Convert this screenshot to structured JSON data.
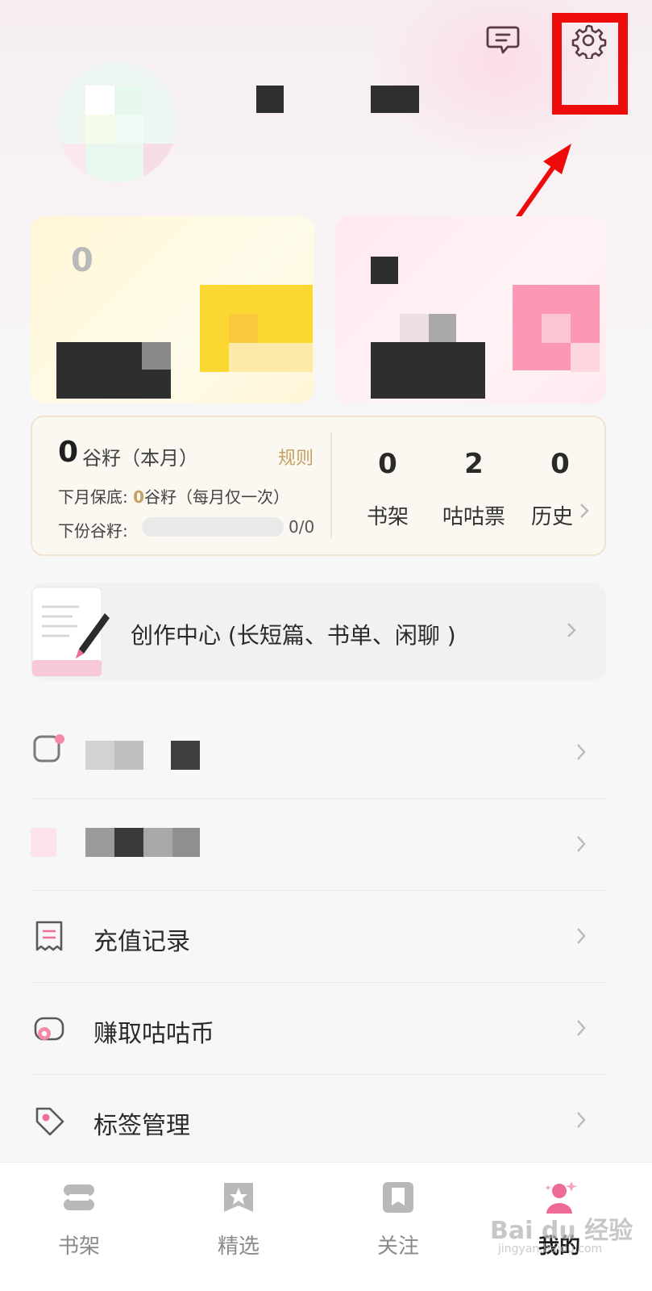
{
  "colors": {
    "accent_gold": "#c6a163",
    "highlight_red": "#ee0b0b",
    "active_pink": "#ec6a93"
  },
  "header": {
    "message_icon": "message-icon",
    "settings_icon": "gear-icon"
  },
  "vip_card": {
    "value": "0"
  },
  "grain": {
    "value": "0",
    "label": "谷籽（本月）",
    "rules": "规则",
    "guarantee_prefix": "下月保底: ",
    "guarantee_value": "0",
    "guarantee_suffix": "谷籽（每月仅一次）",
    "next_label": "下份谷籽:",
    "next_progress": "0/0",
    "next_progress_fraction": 0
  },
  "stats": [
    {
      "value": "0",
      "label": "书架"
    },
    {
      "value": "2",
      "label": "咕咕票"
    },
    {
      "value": "0",
      "label": "历史"
    }
  ],
  "creator_center": {
    "label": "创作中心 (长短篇、书单、闲聊 )"
  },
  "menu": [
    {
      "label": "充值记录",
      "icon": "receipt-icon"
    },
    {
      "label": "赚取咕咕币",
      "icon": "coin-icon"
    },
    {
      "label": "标签管理",
      "icon": "tag-icon"
    }
  ],
  "bottom_nav": [
    {
      "label": "书架",
      "icon": "bookshelf-icon",
      "active": false
    },
    {
      "label": "精选",
      "icon": "star-bookmark-icon",
      "active": false
    },
    {
      "label": "关注",
      "icon": "book-icon",
      "active": false
    },
    {
      "label": "我的",
      "icon": "profile-icon",
      "active": true
    }
  ],
  "watermark": {
    "text": "Bai du 经验",
    "sub": "jingyan.baidu.com"
  }
}
